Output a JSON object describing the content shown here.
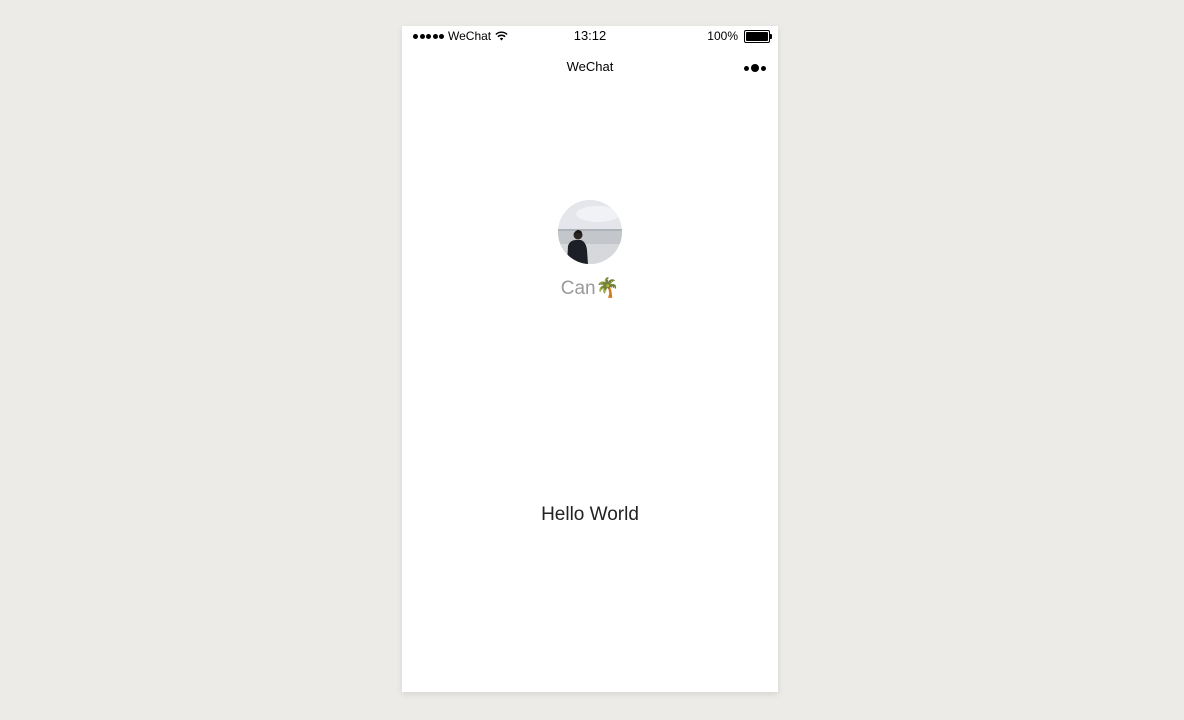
{
  "status_bar": {
    "carrier": "WeChat",
    "time": "13:12",
    "battery": "100%"
  },
  "nav": {
    "title": "WeChat"
  },
  "user": {
    "nickname": "Can🌴"
  },
  "content": {
    "motto": "Hello World"
  },
  "icons": {
    "signal": "signal-dots-icon",
    "wifi": "wifi-icon",
    "battery": "battery-icon",
    "more": "more-dots-icon"
  }
}
